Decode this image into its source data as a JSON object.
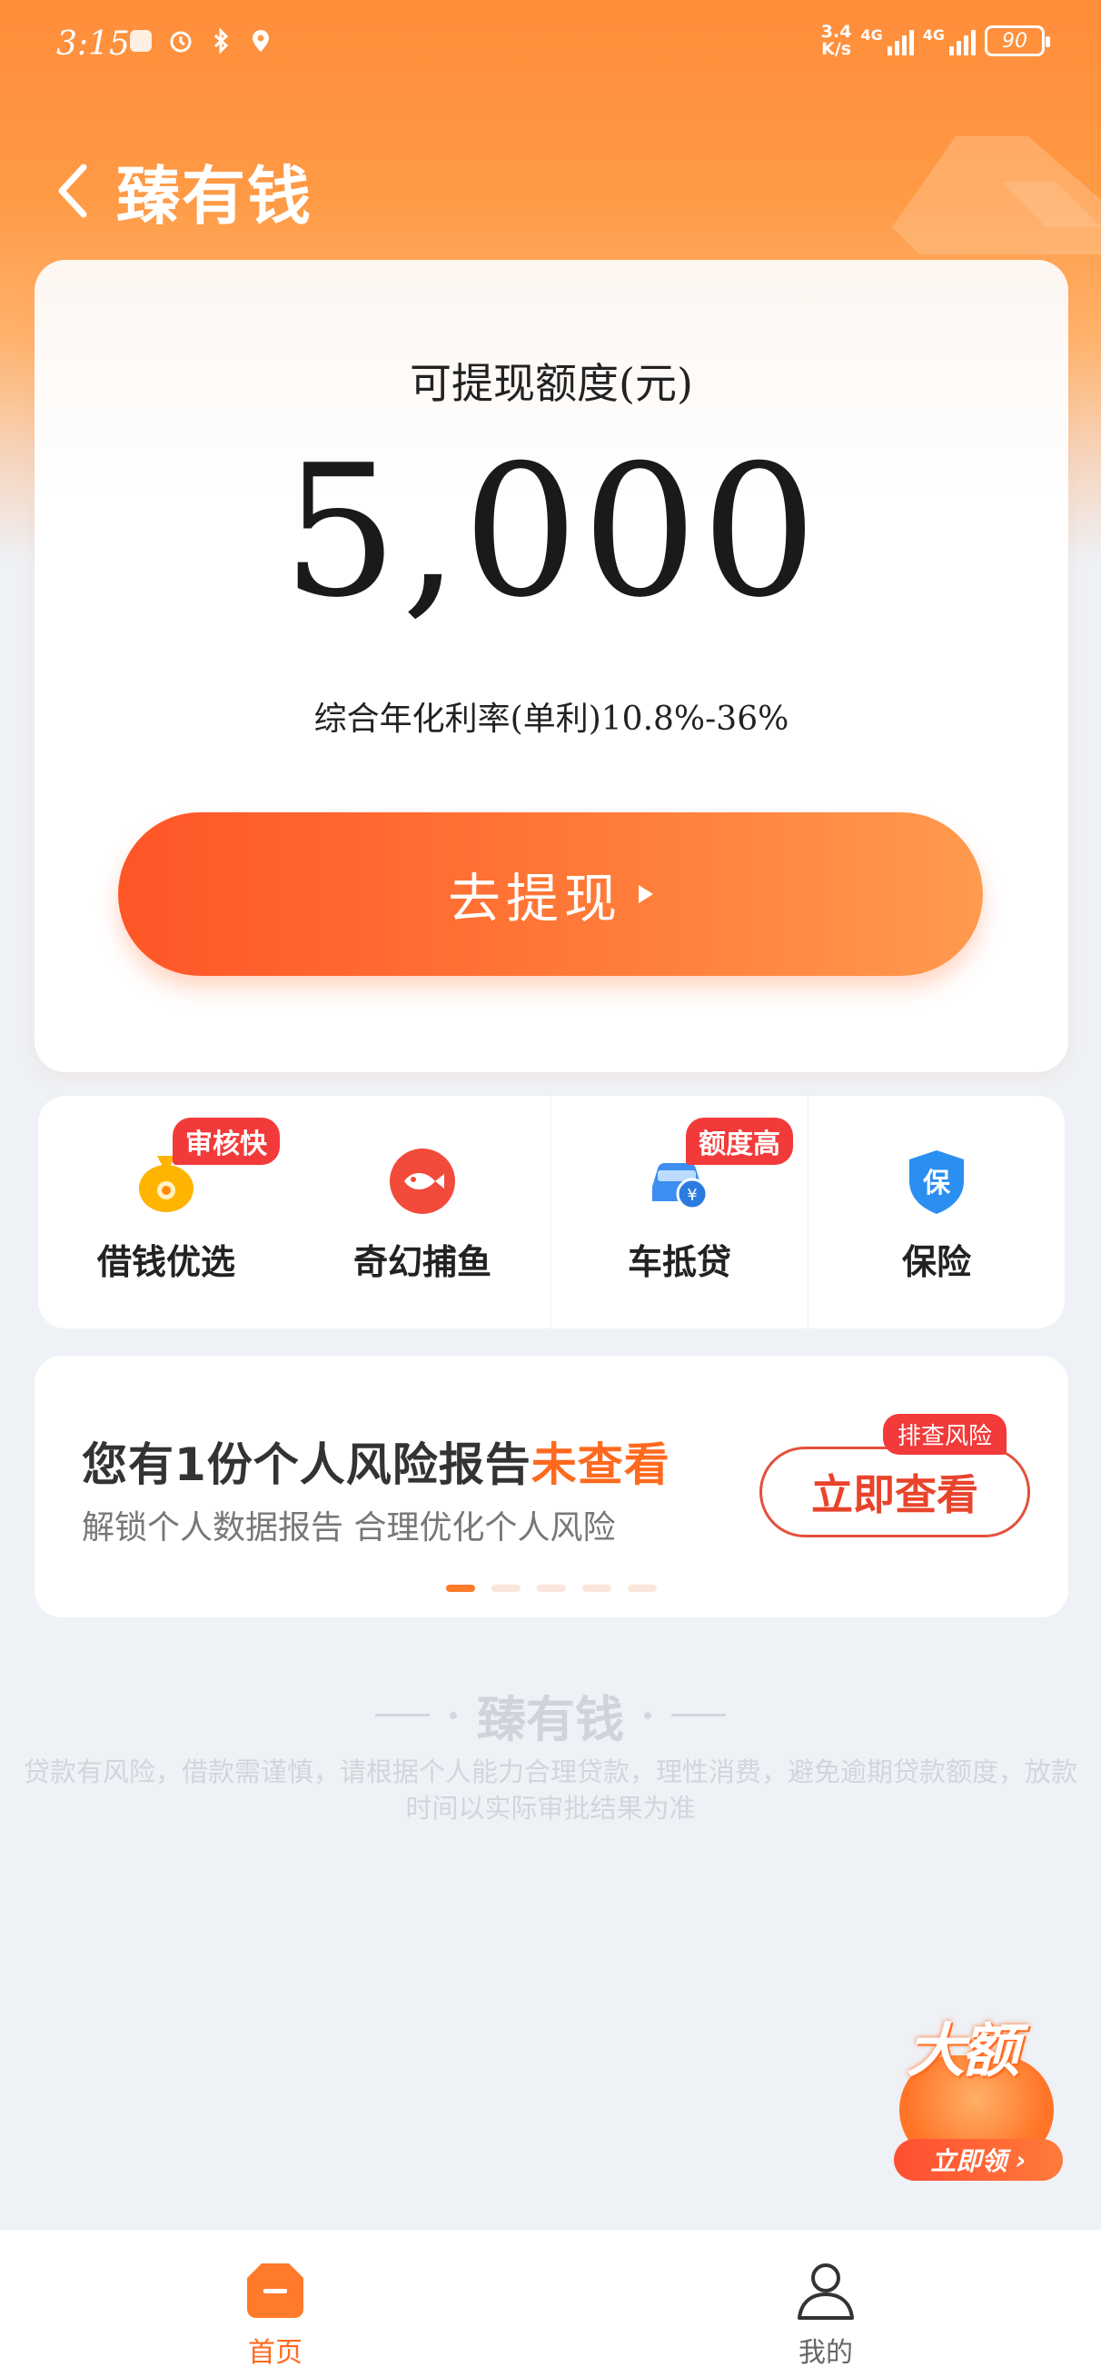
{
  "status_bar": {
    "time": "3:15",
    "net_speed_value": "3.4",
    "net_speed_unit": "K/s",
    "signal1_label": "4G",
    "signal2_label": "4G",
    "battery": "90"
  },
  "header": {
    "title": "臻有钱"
  },
  "quota_card": {
    "label": "可提现额度(元)",
    "amount": "5,000",
    "rate": "综合年化利率(单利)10.8%-36%",
    "withdraw_button": "去提现"
  },
  "quick_actions": [
    {
      "label": "借钱优选",
      "tag": "审核快",
      "icon": "money-bag-icon"
    },
    {
      "label": "奇幻捕鱼",
      "tag": "",
      "icon": "fish-icon"
    },
    {
      "label": "车抵贷",
      "tag": "额度高",
      "icon": "car-loan-icon"
    },
    {
      "label": "保险",
      "tag": "",
      "icon": "shield-icon"
    }
  ],
  "banner": {
    "title_prefix": "您有1份个人风险报告",
    "title_highlight": "未查看",
    "subtitle": "解锁个人数据报告 合理优化个人风险",
    "button": "立即查看",
    "tag": "排查风险",
    "slide_count": 5,
    "active_slide": 0
  },
  "footer": {
    "brand": "臻有钱",
    "disclaimer": "贷款有风险，借款需谨慎，请根据个人能力合理贷款，理性消费，避免逾期贷款额度，放款时间以实际审批结果为准"
  },
  "promo": {
    "word": "大额",
    "button": "立即领"
  },
  "tab_bar": {
    "home": "首页",
    "mine": "我的"
  },
  "colors": {
    "brand_orange": "#ff6a1f",
    "tag_red": "#f23a3a",
    "button_start": "#ff5527",
    "button_end": "#ff9a4e"
  }
}
